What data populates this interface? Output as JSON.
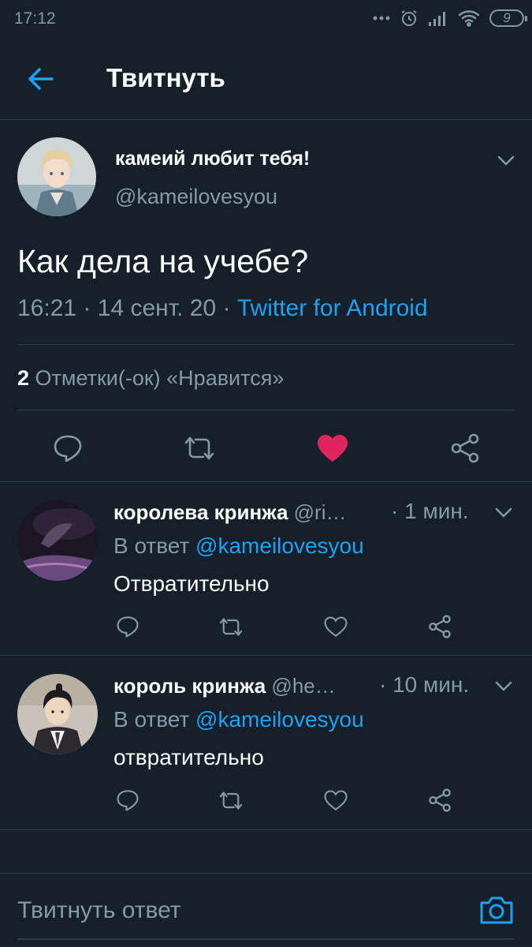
{
  "status_bar": {
    "time": "17:12",
    "battery_level": "9"
  },
  "header": {
    "title": "Твитнуть"
  },
  "tweet": {
    "author_name": "камеий любит тебя!",
    "author_handle": "@kameilovesyou",
    "text": "Как дела на учебе?",
    "time": "16:21",
    "date": "14 сент. 20",
    "separator": "·",
    "source": "Twitter for Android",
    "likes_count": "2",
    "likes_label": "Отметки(-ок) «Нравится»",
    "liked": true
  },
  "replies": [
    {
      "author_name": "королева кринжа",
      "author_handle": "@ri…",
      "time": "· 1 мин.",
      "reply_prefix": "В ответ",
      "reply_to": "@kameilovesyou",
      "text": "Отвратительно"
    },
    {
      "author_name": "король кринжа",
      "author_handle": "@he…",
      "time": "· 10 мин.",
      "reply_prefix": "В ответ",
      "reply_to": "@kameilovesyou",
      "text": "отвратительно"
    }
  ],
  "compose": {
    "placeholder": "Твитнуть ответ"
  },
  "colors": {
    "background": "#15202b",
    "accent": "#1da1f2",
    "like": "#e0245e",
    "secondary_text": "#8899a6",
    "divider": "#2f3d4a"
  }
}
